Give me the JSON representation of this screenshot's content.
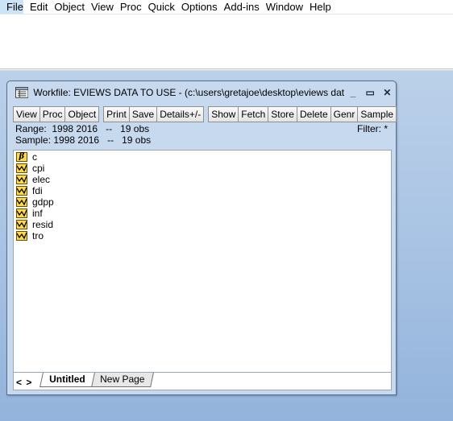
{
  "menubar": {
    "items": [
      "File",
      "Edit",
      "Object",
      "View",
      "Proc",
      "Quick",
      "Options",
      "Add-ins",
      "Window",
      "Help"
    ]
  },
  "workfile": {
    "title": "Workfile: EVIEWS DATA TO USE - (c:\\users\\gretajoe\\desktop\\eviews dat...",
    "window_controls": {
      "minimize": "_",
      "maximize": "▭",
      "close": "✕"
    },
    "toolbar": [
      "View",
      "Proc",
      "Object",
      "Print",
      "Save",
      "Details+/-",
      "Show",
      "Fetch",
      "Store",
      "Delete",
      "Genr",
      "Sample"
    ],
    "range_label": "Range:",
    "range_value": "1998 2016   --   19 obs",
    "sample_label": "Sample:",
    "sample_value": "1998 2016   --   19 obs",
    "filter_text": "Filter: *",
    "objects": [
      {
        "name": "c",
        "type": "coefficient",
        "icon": "beta-icon"
      },
      {
        "name": "cpi",
        "type": "series",
        "icon": "series-icon"
      },
      {
        "name": "elec",
        "type": "series",
        "icon": "series-icon"
      },
      {
        "name": "fdi",
        "type": "series",
        "icon": "series-icon"
      },
      {
        "name": "gdpp",
        "type": "series",
        "icon": "series-icon"
      },
      {
        "name": "inf",
        "type": "series",
        "icon": "series-icon"
      },
      {
        "name": "resid",
        "type": "series",
        "icon": "series-icon"
      },
      {
        "name": "tro",
        "type": "series",
        "icon": "series-icon"
      }
    ],
    "tabs": {
      "nav": "< >",
      "active": "Untitled",
      "new_page": "New Page"
    }
  },
  "colors": {
    "desktop": "#aac4e4",
    "window_frame": "#c6d9ef",
    "icon_fill": "#ffd84a"
  }
}
